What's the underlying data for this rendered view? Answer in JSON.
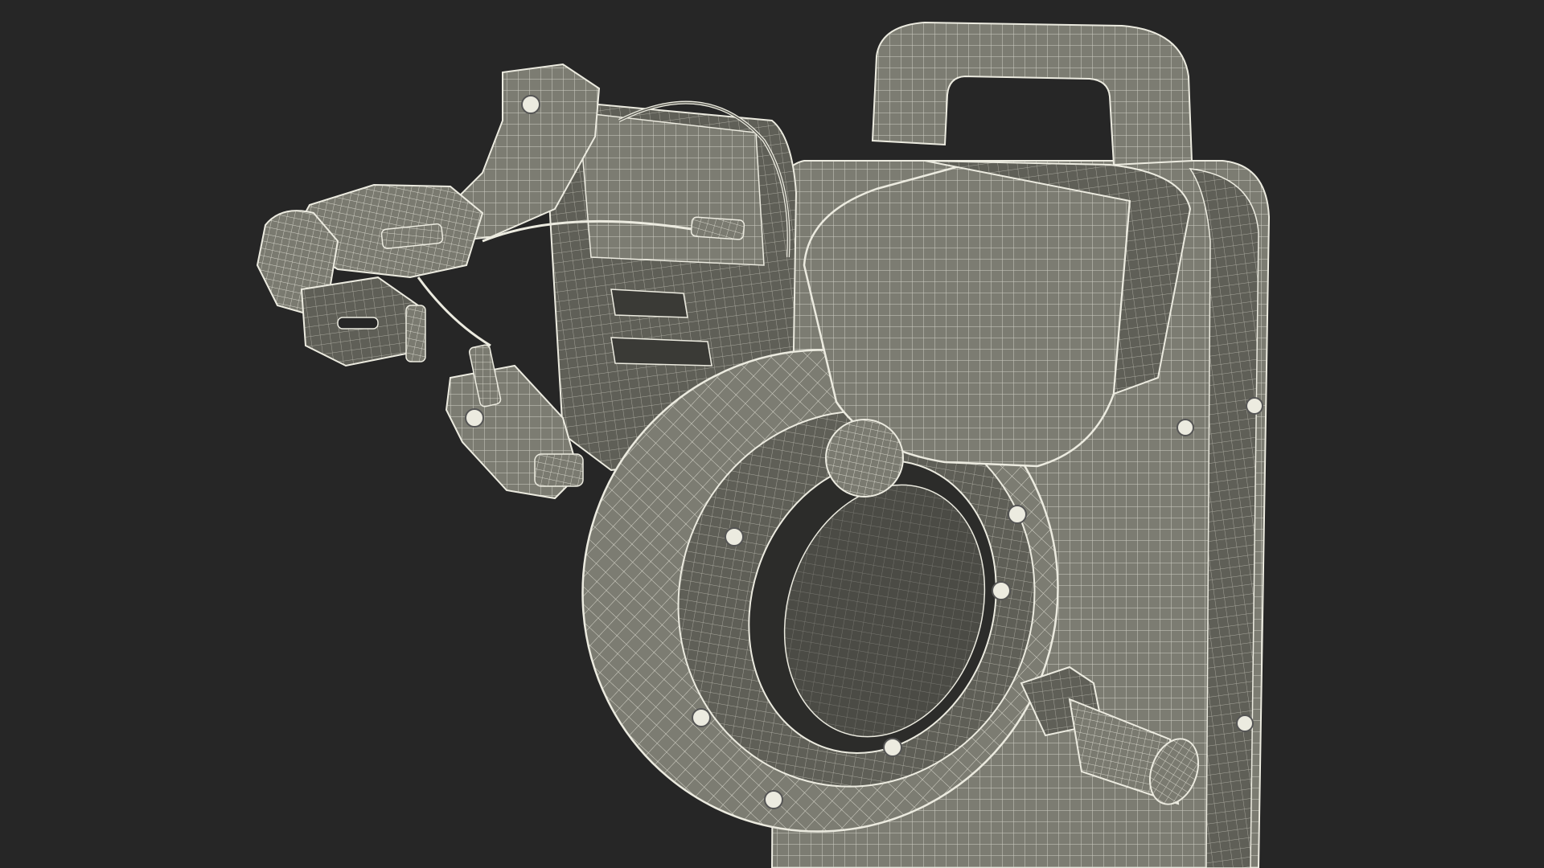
{
  "scene": {
    "background": "#262626",
    "model_fill": "#7c7c72",
    "model_shade": "#5f5f57",
    "wire_color": "#ecebe0",
    "wire_dim": "#c9c8bd"
  }
}
